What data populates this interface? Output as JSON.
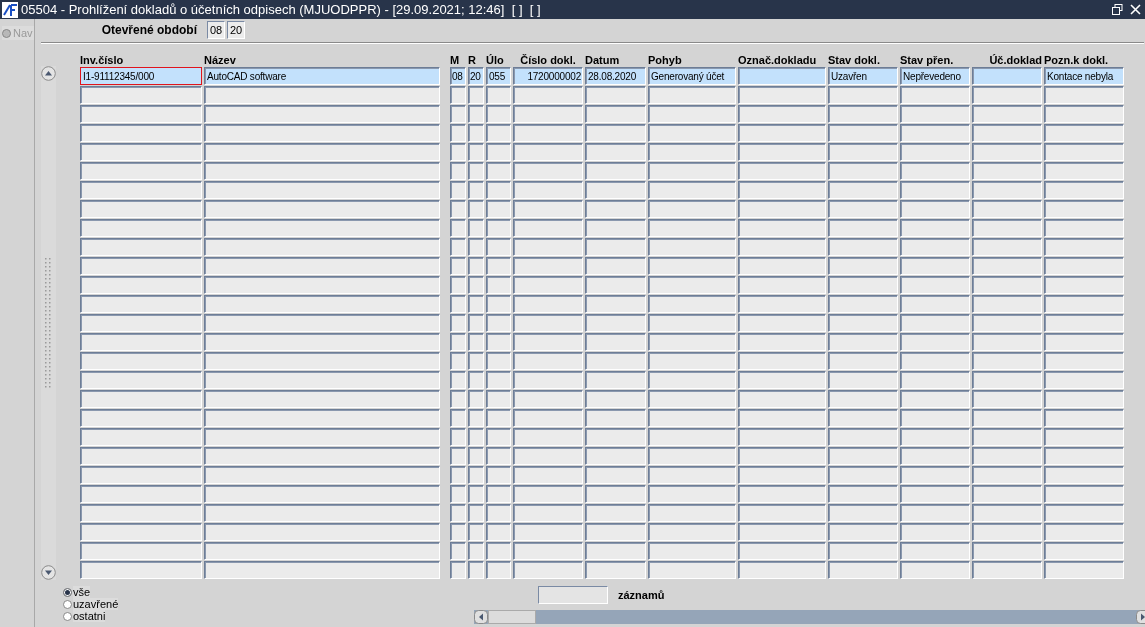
{
  "window": {
    "title": "05504 - Prohlížení dokladů o účetních odpisech (MJUODPPR) - [29.09.2021; 12:46]  [ ]  [ ]"
  },
  "nav": {
    "label": "Nav",
    "disabled": true
  },
  "period": {
    "label": "Otevřené období",
    "fields": [
      "08",
      "20"
    ]
  },
  "table": {
    "columns": [
      "Inv.číslo",
      "Název",
      "M",
      "R",
      "Úlo",
      "Číslo dokl.",
      "Datum",
      "Pohyb",
      "Označ.dokladu",
      "Stav dokl.",
      "Stav přen.",
      "Úč.doklad",
      "Pozn.k dokl."
    ],
    "rows": [
      {
        "selected": true,
        "cells": [
          {
            "text": "I1-91112345/000",
            "focused": true
          },
          {
            "text": "AutoCAD software",
            "focused": false
          },
          {
            "text": "08",
            "focused": false
          },
          {
            "text": "20",
            "focused": false
          },
          {
            "text": "055",
            "focused": false
          },
          {
            "text": "1720000002",
            "focused": false
          },
          {
            "text": "28.08.2020",
            "focused": false
          },
          {
            "text": "Generovaný účet",
            "focused": false
          },
          {
            "focused": false
          },
          {
            "text": "Uzavřen",
            "focused": false
          },
          {
            "text": "Nepřevedeno",
            "focused": false
          },
          {
            "focused": false
          },
          {
            "text": "Kontace nebyla",
            "focused": false
          }
        ]
      }
    ]
  },
  "filter": [
    {
      "label": "vše",
      "selected": true
    },
    {
      "label": "uzavřené",
      "selected": false
    },
    {
      "label": "ostatni",
      "selected": false
    }
  ],
  "count": {
    "label": "záznamů"
  }
}
